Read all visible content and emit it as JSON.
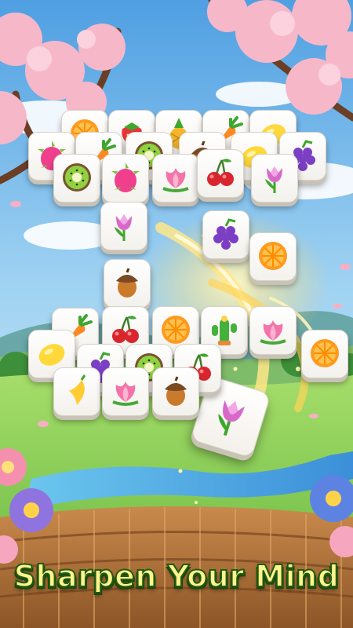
{
  "game": {
    "slogan": "Sharpen Your Mind"
  },
  "colors": {
    "sky_top": "#5aa9e6",
    "meadow": "#8dd25e",
    "blossom": "#f6b8c8",
    "slogan_fill": "#fff38c",
    "slogan_outline": "#215a12"
  },
  "board": {
    "layers": [
      [
        "orange",
        "strawberry",
        "pineapple",
        "carrot",
        "lemon"
      ],
      [
        "dragonfruit",
        "carrot",
        "kiwi",
        "acorn",
        "lemon",
        "grape"
      ],
      [
        "kiwi",
        "dragonfruit",
        "lotus",
        "tulip",
        "cherry"
      ],
      [
        "tulip",
        "grape",
        "acorn",
        "orange"
      ],
      [
        "carrot",
        "cherry",
        "orange",
        "cactus",
        "lotus"
      ],
      [
        "lemon",
        "grape",
        "kiwi",
        "cherry",
        "orange"
      ],
      [
        "pepper",
        "lotus",
        "acorn"
      ]
    ],
    "selected_tile": "tulip"
  }
}
